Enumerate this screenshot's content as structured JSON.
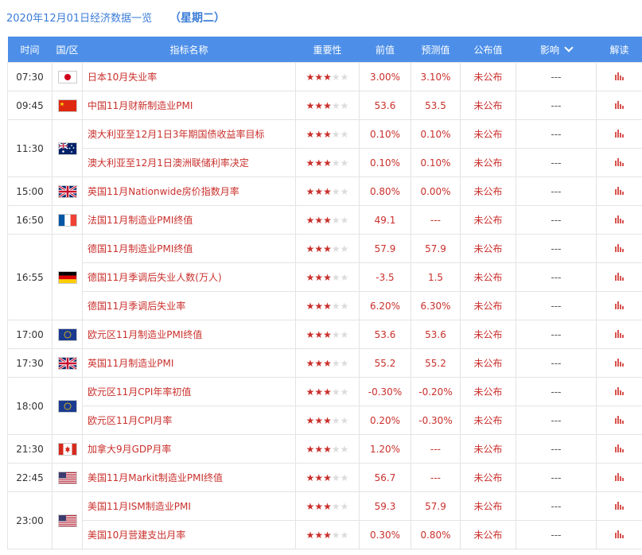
{
  "header": {
    "date_title": "2020年12月01日经济数据一览",
    "weekday": "（星期二）"
  },
  "columns": {
    "time": "时间",
    "country": "国/区",
    "name": "指标名称",
    "importance": "重要性",
    "previous": "前值",
    "forecast": "预测值",
    "actual": "公布值",
    "impact": "影响",
    "analysis": "解读"
  },
  "groups": [
    {
      "time": "07:30",
      "flag": "japan-flag-icon",
      "rows": [
        {
          "name": "日本10月失业率",
          "stars": 3,
          "previous": "3.00%",
          "forecast": "3.10%",
          "actual": "未公布",
          "impact": "---"
        }
      ]
    },
    {
      "time": "09:45",
      "flag": "china-flag-icon",
      "rows": [
        {
          "name": "中国11月财新制造业PMI",
          "stars": 3,
          "previous": "53.6",
          "forecast": "53.5",
          "actual": "未公布",
          "impact": "---"
        }
      ]
    },
    {
      "time": "11:30",
      "flag": "australia-flag-icon",
      "rows": [
        {
          "name": "澳大利亚至12月1日3年期国债收益率目标",
          "stars": 3,
          "previous": "0.10%",
          "forecast": "0.10%",
          "actual": "未公布",
          "impact": "---"
        },
        {
          "name": "澳大利亚至12月1日澳洲联储利率决定",
          "stars": 3,
          "previous": "0.10%",
          "forecast": "0.10%",
          "actual": "未公布",
          "impact": "---"
        }
      ]
    },
    {
      "time": "15:00",
      "flag": "uk-flag-icon",
      "rows": [
        {
          "name": "英国11月Nationwide房价指数月率",
          "stars": 3,
          "previous": "0.80%",
          "forecast": "0.00%",
          "actual": "未公布",
          "impact": "---"
        }
      ]
    },
    {
      "time": "16:50",
      "flag": "france-flag-icon",
      "rows": [
        {
          "name": "法国11月制造业PMI终值",
          "stars": 3,
          "previous": "49.1",
          "forecast": "---",
          "actual": "未公布",
          "impact": "---"
        }
      ]
    },
    {
      "time": "16:55",
      "flag": "germany-flag-icon",
      "rows": [
        {
          "name": "德国11月制造业PMI终值",
          "stars": 3,
          "previous": "57.9",
          "forecast": "57.9",
          "actual": "未公布",
          "impact": "---"
        },
        {
          "name": "德国11月季调后失业人数(万人)",
          "stars": 3,
          "previous": "-3.5",
          "forecast": "1.5",
          "actual": "未公布",
          "impact": "---"
        },
        {
          "name": "德国11月季调后失业率",
          "stars": 3,
          "previous": "6.20%",
          "forecast": "6.30%",
          "actual": "未公布",
          "impact": "---"
        }
      ]
    },
    {
      "time": "17:00",
      "flag": "eu-flag-icon",
      "rows": [
        {
          "name": "欧元区11月制造业PMI终值",
          "stars": 3,
          "previous": "53.6",
          "forecast": "53.6",
          "actual": "未公布",
          "impact": "---"
        }
      ]
    },
    {
      "time": "17:30",
      "flag": "uk-flag-icon",
      "rows": [
        {
          "name": "英国11月制造业PMI",
          "stars": 3,
          "previous": "55.2",
          "forecast": "55.2",
          "actual": "未公布",
          "impact": "---"
        }
      ]
    },
    {
      "time": "18:00",
      "flag": "eu-flag-icon",
      "rows": [
        {
          "name": "欧元区11月CPI年率初值",
          "stars": 3,
          "previous": "-0.30%",
          "forecast": "-0.20%",
          "actual": "未公布",
          "impact": "---"
        },
        {
          "name": "欧元区11月CPI月率",
          "stars": 3,
          "previous": "0.20%",
          "forecast": "-0.30%",
          "actual": "未公布",
          "impact": "---"
        }
      ]
    },
    {
      "time": "21:30",
      "flag": "canada-flag-icon",
      "rows": [
        {
          "name": "加拿大9月GDP月率",
          "stars": 3,
          "previous": "1.20%",
          "forecast": "---",
          "actual": "未公布",
          "impact": "---"
        }
      ]
    },
    {
      "time": "22:45",
      "flag": "usa-flag-icon",
      "rows": [
        {
          "name": "美国11月Markit制造业PMI终值",
          "stars": 3,
          "previous": "56.7",
          "forecast": "---",
          "actual": "未公布",
          "impact": "---"
        }
      ]
    },
    {
      "time": "23:00",
      "flag": "usa-flag-icon",
      "rows": [
        {
          "name": "美国11月ISM制造业PMI",
          "stars": 3,
          "previous": "59.3",
          "forecast": "57.9",
          "actual": "未公布",
          "impact": "---"
        },
        {
          "name": "美国10月营建支出月率",
          "stars": 3,
          "previous": "0.30%",
          "forecast": "0.80%",
          "actual": "未公布",
          "impact": "---"
        }
      ]
    }
  ],
  "max_stars": 5,
  "colors": {
    "header_bg": "#4d8fe8",
    "title_blue": "#3b7dd8",
    "value_red": "#c9302c",
    "star_off": "#dcdcdc"
  }
}
